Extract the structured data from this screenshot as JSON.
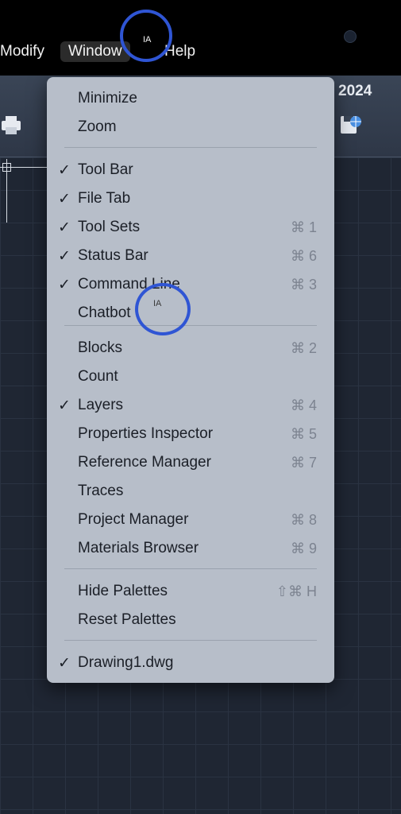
{
  "menubar": {
    "items": [
      "Modify",
      "Window",
      "Help"
    ]
  },
  "toolbar": {
    "year": "2024"
  },
  "cursor_text": "IA",
  "menu": {
    "items": [
      {
        "label": "Minimize",
        "check": "",
        "shortcut": ""
      },
      {
        "label": "Zoom",
        "check": "",
        "shortcut": ""
      },
      {
        "label": "Tool Bar",
        "check": "✓",
        "shortcut": ""
      },
      {
        "label": "File Tab",
        "check": "✓",
        "shortcut": ""
      },
      {
        "label": "Tool Sets",
        "check": "✓",
        "shortcut": "⌘ 1"
      },
      {
        "label": "Status Bar",
        "check": "✓",
        "shortcut": "⌘ 6"
      },
      {
        "label": "Command Line",
        "check": "✓",
        "shortcut": "⌘ 3"
      },
      {
        "label": "Chatbot",
        "check": "",
        "shortcut": ""
      },
      {
        "label": "Blocks",
        "check": "",
        "shortcut": "⌘ 2"
      },
      {
        "label": "Count",
        "check": "",
        "shortcut": ""
      },
      {
        "label": "Layers",
        "check": "✓",
        "shortcut": "⌘ 4"
      },
      {
        "label": "Properties Inspector",
        "check": "",
        "shortcut": "⌘ 5"
      },
      {
        "label": "Reference Manager",
        "check": "",
        "shortcut": "⌘ 7"
      },
      {
        "label": "Traces",
        "check": "",
        "shortcut": ""
      },
      {
        "label": "Project Manager",
        "check": "",
        "shortcut": "⌘ 8"
      },
      {
        "label": "Materials Browser",
        "check": "",
        "shortcut": "⌘ 9"
      },
      {
        "label": "Hide Palettes",
        "check": "",
        "shortcut": "⇧⌘ H"
      },
      {
        "label": "Reset Palettes",
        "check": "",
        "shortcut": ""
      },
      {
        "label": "Drawing1.dwg",
        "check": "✓",
        "shortcut": ""
      }
    ]
  },
  "colors": {
    "menu_bg": "#b7bec9",
    "ring": "#2f55d4",
    "menubar_bg": "#000000"
  }
}
